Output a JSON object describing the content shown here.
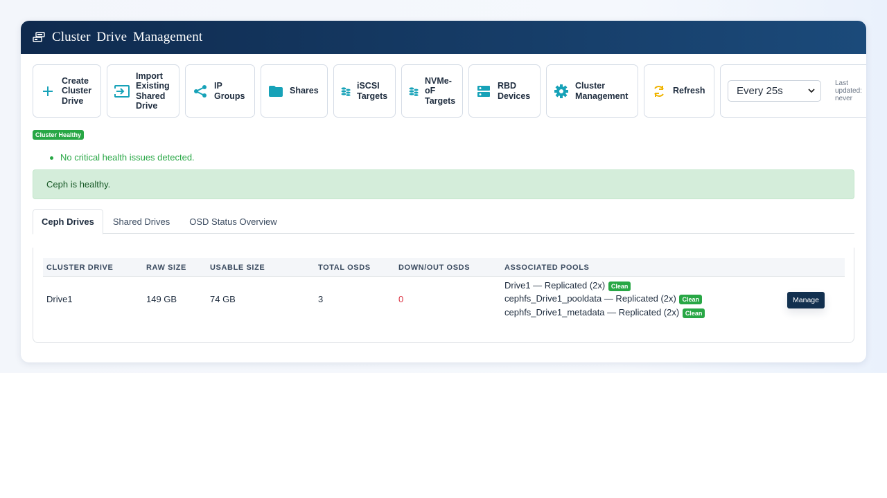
{
  "header": {
    "title": "Cluster Drive Management",
    "icon": "server-icon"
  },
  "toolbar": {
    "buttons": [
      {
        "label": "Create\nCluster\nDrive",
        "icon": "plus-icon"
      },
      {
        "label": "Import\nExisting\nShared\nDrive",
        "icon": "import-icon"
      },
      {
        "label": "IP\nGroups",
        "icon": "share-nodes-icon"
      },
      {
        "label": "Shares",
        "icon": "folder-icon"
      },
      {
        "label": "iSCSI\nTargets",
        "icon": "database-stack-icon"
      },
      {
        "label": "NVMe-\noF\nTargets",
        "icon": "database-stack-icon"
      },
      {
        "label": "RBD\nDevices",
        "icon": "server-rack-icon"
      },
      {
        "label": "Cluster\nManagement",
        "icon": "gear-icon"
      },
      {
        "label": "Refresh",
        "icon": "refresh-icon"
      }
    ],
    "refresh_interval": "Every 25s",
    "last_updated": "Last\nupdated:\nnever"
  },
  "health": {
    "badge": "Cluster Healthy",
    "issues": [
      "No critical health issues detected."
    ],
    "alert": "Ceph is healthy."
  },
  "tabs": [
    {
      "label": "Ceph Drives",
      "active": true
    },
    {
      "label": "Shared Drives",
      "active": false
    },
    {
      "label": "OSD Status Overview",
      "active": false
    }
  ],
  "table": {
    "headers": [
      "CLUSTER DRIVE",
      "RAW SIZE",
      "USABLE SIZE",
      "TOTAL OSDS",
      "DOWN/OUT OSDS",
      "ASSOCIATED POOLS"
    ],
    "rows": [
      {
        "drive": "Drive1",
        "raw": "149 GB",
        "usable": "74 GB",
        "total_osds": "3",
        "down_osds": "0",
        "pools": [
          {
            "text": "Drive1 — Replicated (2x)",
            "status": "Clean"
          },
          {
            "text": "cephfs_Drive1_pooldata — Replicated (2x)",
            "status": "Clean"
          },
          {
            "text": "cephfs_Drive1_metadata — Replicated (2x)",
            "status": "Clean"
          }
        ],
        "action": "Manage"
      }
    ]
  },
  "colors": {
    "accent": "#17a2b8",
    "healthy": "#28a745",
    "danger": "#dc3545",
    "header": "#12304f",
    "refresh": "#f0b400"
  }
}
